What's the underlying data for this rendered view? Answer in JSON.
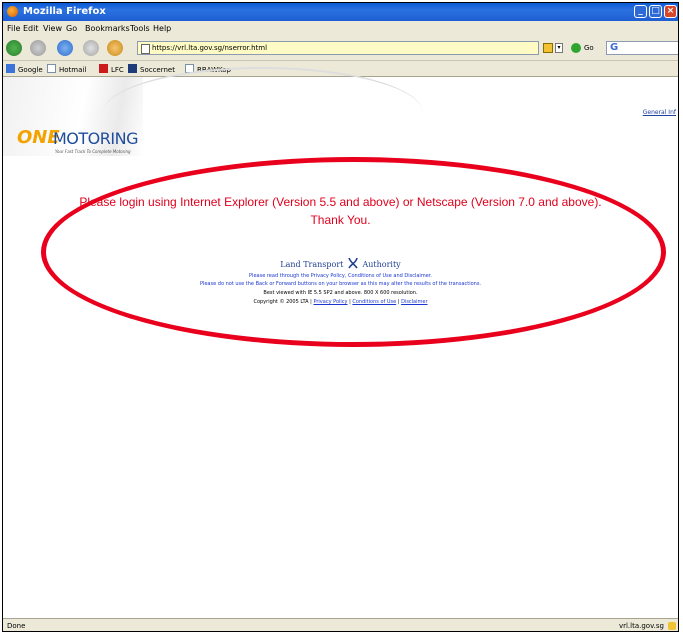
{
  "window": {
    "title": "Mozilla Firefox"
  },
  "menu": [
    {
      "label": "File"
    },
    {
      "label": "Edit"
    },
    {
      "label": "View"
    },
    {
      "label": "Go"
    },
    {
      "label": "Bookmarks"
    },
    {
      "label": "Tools"
    },
    {
      "label": "Help"
    }
  ],
  "nav": {
    "url": "https://vrl.lta.gov.sg/nserror.html",
    "go_label": "Go",
    "search_prefix": "G"
  },
  "bookmarks": [
    {
      "label": "Google"
    },
    {
      "label": "Hotmail"
    },
    {
      "label": "LFC"
    },
    {
      "label": "Soccernet"
    },
    {
      "label": "RBAWKop"
    }
  ],
  "site": {
    "logo_one": "ONE",
    "logo_motoring": "MOTORING",
    "logo_tagline": "Your Fast Track To Complete Motoring",
    "general_link": "General Inf"
  },
  "message": {
    "line1": "Please login using Internet Explorer (Version 5.5 and above) or Netscape (Version 7.0 and above).",
    "line2": "Thank You."
  },
  "lta": {
    "left": "Land Transport",
    "right": "Authority"
  },
  "footer": {
    "privacy_note": "Please read through the Privacy Policy, Conditions of Use and Disclaimer.",
    "back_note": "Please do not use the Back or Forward buttons on your browser as this may alter the results of the transactions.",
    "best_viewed": "Best viewed with IE 5.5 SP2 and above. 800 X 600 resolution.",
    "copyright": "Copyright © 2005 LTA |",
    "privacy_link": "Privacy Policy",
    "conditions_link": "Conditions of Use",
    "disclaimer_link": "Disclaimer",
    "sep": "|"
  },
  "status": {
    "left": "Done",
    "right": "vrl.lta.gov.sg"
  },
  "colors": {
    "accent_red": "#e8001c",
    "link_blue": "#1b36d0",
    "title_blue": "#0a5bd6"
  }
}
